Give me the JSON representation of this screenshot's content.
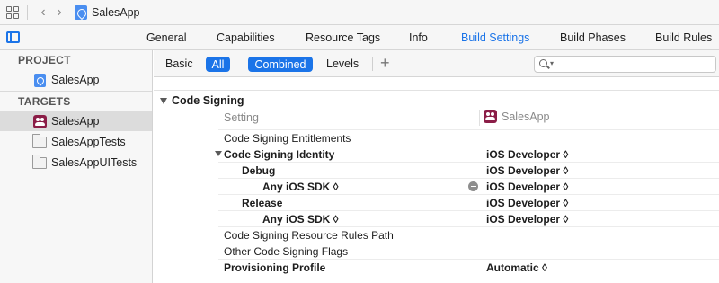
{
  "jumpbar": {
    "title": "SalesApp"
  },
  "tabs": [
    "General",
    "Capabilities",
    "Resource Tags",
    "Info",
    "Build Settings",
    "Build Phases",
    "Build Rules"
  ],
  "active_tab": "Build Settings",
  "sidebar": {
    "project_header": "PROJECT",
    "project_item": "SalesApp",
    "targets_header": "TARGETS",
    "targets": [
      "SalesApp",
      "SalesAppTests",
      "SalesAppUITests"
    ],
    "selected_target": "SalesApp"
  },
  "filter": {
    "basic": "Basic",
    "all": "All",
    "combined": "Combined",
    "levels": "Levels",
    "add": "+",
    "search_placeholder": ""
  },
  "content": {
    "section_title": "Code Signing",
    "setting_header": "Setting",
    "target_header": "SalesApp",
    "rows": [
      {
        "name": "Code Signing Entitlements",
        "value": ""
      },
      {
        "name": "Code Signing Identity",
        "value": "iOS Developer ◊"
      },
      {
        "name": "Debug",
        "value": "iOS Developer ◊"
      },
      {
        "name": "Any iOS SDK ◊",
        "value": "iOS Developer ◊"
      },
      {
        "name": "Release",
        "value": "iOS Developer ◊"
      },
      {
        "name": "Any iOS SDK ◊",
        "value": "iOS Developer ◊"
      },
      {
        "name": "Code Signing Resource Rules Path",
        "value": ""
      },
      {
        "name": "Other Code Signing Flags",
        "value": ""
      },
      {
        "name": "Provisioning Profile",
        "value": "Automatic ◊"
      }
    ]
  },
  "colors": {
    "accent": "#1b74e8",
    "app_icon": "#8b1d47"
  }
}
